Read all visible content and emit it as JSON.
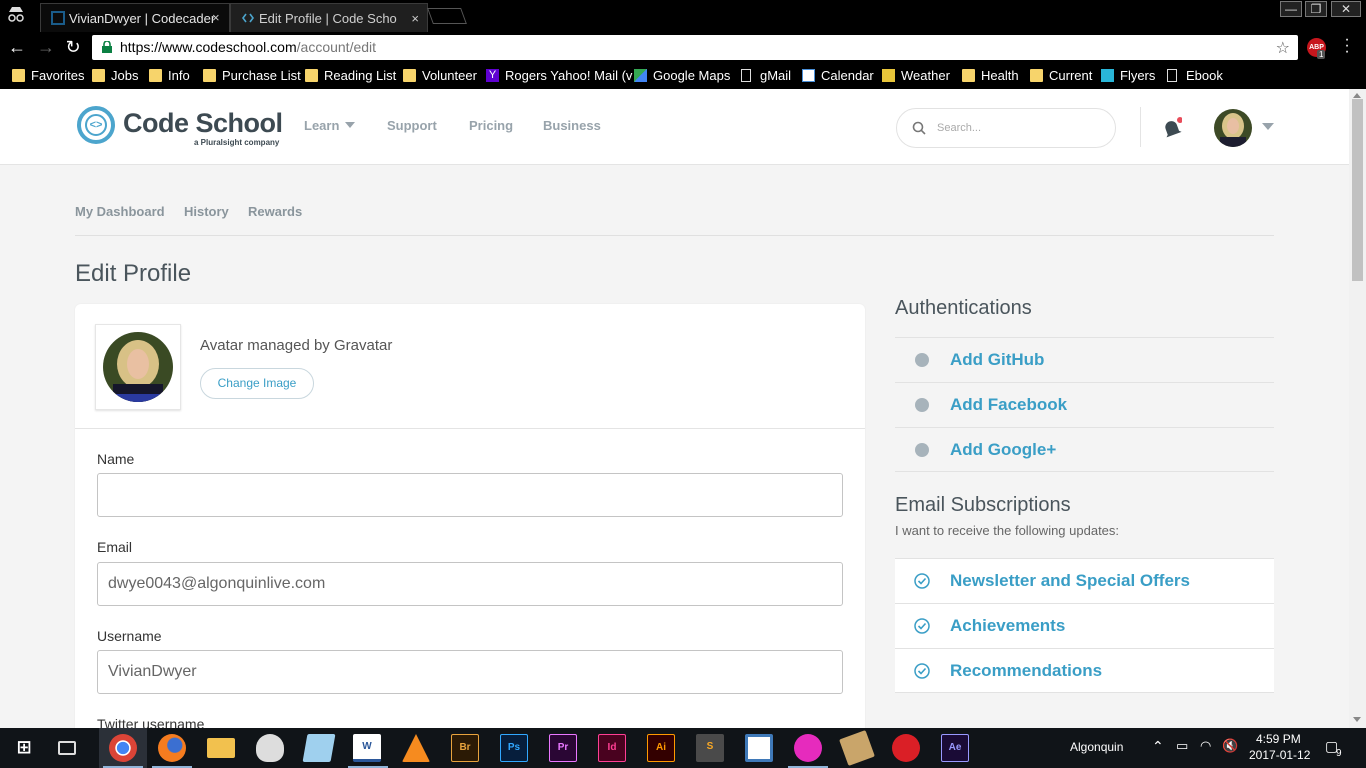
{
  "browser": {
    "tabs": [
      {
        "title": "VivianDwyer | Codecader",
        "active": false
      },
      {
        "title": "Edit Profile | Code Scho",
        "active": true
      }
    ],
    "tab_close": "×",
    "window_controls": {
      "minimize": "—",
      "restore": "❐",
      "close": "✕"
    },
    "url_host": "https://www.codeschool.com",
    "url_path": "/account/edit",
    "abp_label": "ABP",
    "abp_count": "1",
    "bookmarks": [
      {
        "label": "Favorites",
        "icon": "folder"
      },
      {
        "label": "Jobs",
        "icon": "folder"
      },
      {
        "label": "Info",
        "icon": "folder"
      },
      {
        "label": "Purchase List",
        "icon": "folder"
      },
      {
        "label": "Reading List",
        "icon": "folder"
      },
      {
        "label": "Volunteer",
        "icon": "folder"
      },
      {
        "label": "Rogers Yahoo! Mail (v",
        "icon": "yahoo"
      },
      {
        "label": "Google Maps",
        "icon": "maps"
      },
      {
        "label": "gMail",
        "icon": "page"
      },
      {
        "label": "Calendar",
        "icon": "calendar"
      },
      {
        "label": "Weather",
        "icon": "weather"
      },
      {
        "label": "Health",
        "icon": "folder"
      },
      {
        "label": "Current",
        "icon": "folder"
      },
      {
        "label": "Flyers",
        "icon": "flyers"
      },
      {
        "label": "Ebook",
        "icon": "page"
      }
    ]
  },
  "site": {
    "logo_name": "Code School",
    "logo_tagline": "a Pluralsight company",
    "nav": {
      "learn": "Learn",
      "support": "Support",
      "pricing": "Pricing",
      "business": "Business"
    },
    "search_placeholder": "Search..."
  },
  "subnav": {
    "dashboard": "My Dashboard",
    "history": "History",
    "rewards": "Rewards"
  },
  "page_title": "Edit Profile",
  "profile": {
    "avatar_text": "Avatar managed by Gravatar",
    "change_image": "Change Image",
    "name_label": "Name",
    "name_value": "",
    "email_label": "Email",
    "email_value": "dwye0043@algonquinlive.com",
    "username_label": "Username",
    "username_value": "VivianDwyer",
    "twitter_label": "Twitter username"
  },
  "authentications": {
    "title": "Authentications",
    "items": [
      "Add GitHub",
      "Add Facebook",
      "Add Google+"
    ]
  },
  "email_subscriptions": {
    "title": "Email Subscriptions",
    "subtitle": "I want to receive the following updates:",
    "items": [
      "Newsletter and Special Offers",
      "Achievements",
      "Recommendations"
    ]
  },
  "colors": {
    "accent": "#3a9ec6",
    "muted": "#98a3ab",
    "heading": "#4a555c"
  },
  "taskbar": {
    "apps": [
      "start",
      "task-view",
      "chrome",
      "firefox",
      "file-explorer",
      "paint",
      "notepad",
      "word",
      "vlc",
      "bridge",
      "photoshop",
      "premiere",
      "indesign",
      "illustrator",
      "sublime",
      "bracket-app",
      "wamp",
      "scroll-app",
      "creative-cloud",
      "after-effects"
    ],
    "app_labels": {
      "word": "W",
      "bridge": "Br",
      "photoshop": "Ps",
      "premiere": "Pr",
      "indesign": "Id",
      "illustrator": "Ai",
      "after-effects": "Ae",
      "sublime": "S"
    },
    "network_name": "Algonquin",
    "time": "4:59 PM",
    "date": "2017-01-12",
    "notifications": "9"
  }
}
